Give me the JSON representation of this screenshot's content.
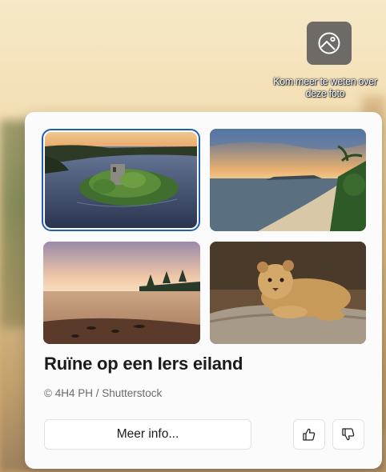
{
  "spotlight": {
    "learn_more_label": "Kom meer te weten over deze foto",
    "learn_more_icon": "image-icon"
  },
  "flyout": {
    "thumbnails": [
      {
        "id": "ruin-island",
        "selected": true
      },
      {
        "id": "beach-sunset-palms",
        "selected": false
      },
      {
        "id": "beach-reflection",
        "selected": false
      },
      {
        "id": "lion-cub",
        "selected": false
      }
    ],
    "title": "Ruïne op een Iers eiland",
    "credit": "© 4H4 PH / Shutterstock",
    "more_info_label": "Meer info...",
    "like_icon": "thumbs-up-icon",
    "dislike_icon": "thumbs-down-icon",
    "accent_color": "#1f5fb2"
  }
}
